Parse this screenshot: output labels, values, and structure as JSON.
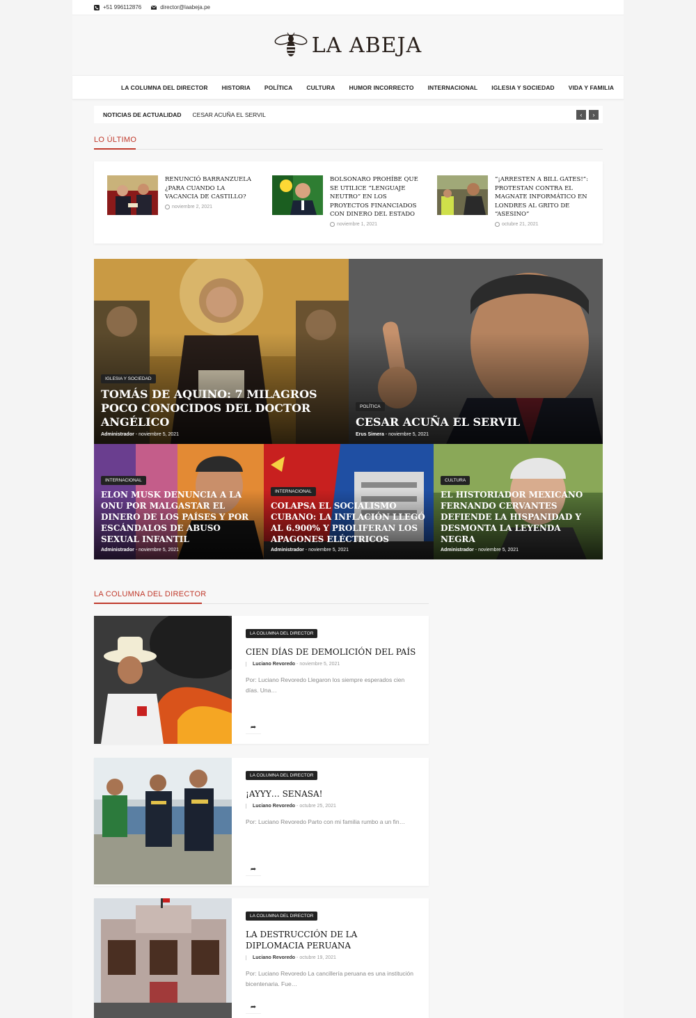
{
  "topbar": {
    "phone": "+51 996112876",
    "email": "director@laabeja.pe",
    "phone_icon": "phone-icon",
    "email_icon": "envelope-icon"
  },
  "brand": {
    "name": "LA ABEJA",
    "logo_icon": "bee-icon"
  },
  "nav": {
    "items": [
      "LA COLUMNA DEL DIRECTOR",
      "HISTORIA",
      "POLÍTICA",
      "CULTURA",
      "HUMOR INCORRECTO",
      "INTERNACIONAL",
      "IGLESIA Y SOCIEDAD",
      "VIDA Y FAMILIA"
    ],
    "menu_icon": "hamburger-icon",
    "search_icon": "search-icon"
  },
  "ticker": {
    "label": "NOTICIAS DE ACTUALIDAD",
    "text": "CESAR ACUÑA EL SERVIL",
    "prev_icon": "chevron-left-icon",
    "next_icon": "chevron-right-icon"
  },
  "latest": {
    "title": "LO ÚLTIMO",
    "items": [
      {
        "title": "RENUNCIÓ BARRANZUELA ¿PARA CUANDO LA VACANCIA DE CASTILLO?",
        "date": "noviembre 2, 2021"
      },
      {
        "title": "BOLSONARO PROHÍBE QUE SE UTILICE “LENGUAJE NEUTRO” EN LOS PROYECTOS FINANCIADOS CON DINERO DEL ESTADO",
        "date": "noviembre 1, 2021"
      },
      {
        "title": "“¡ARRESTEN A BILL GATES!”: PROTESTAN CONTRA EL MAGNATE INFORMÁTICO EN LONDRES AL GRITO DE “ASESINO”",
        "date": "octubre 21, 2021"
      }
    ]
  },
  "featured": {
    "top": [
      {
        "category": "IGLESIA Y SOCIEDAD",
        "title": "TOMÁS DE AQUINO: 7 MILAGROS POCO CONOCIDOS DEL DOCTOR ANGÉLICO",
        "author": "Administrador",
        "date": "noviembre 5, 2021"
      },
      {
        "category": "POLÍTICA",
        "title": "CESAR ACUÑA EL SERVIL",
        "author": "Erus Simera",
        "date": "noviembre 5, 2021"
      }
    ],
    "bottom": [
      {
        "category": "INTERNACIONAL",
        "title": "ELON MUSK DENUNCIA A LA ONU POR MALGASTAR EL DINERO DE LOS PAÍSES Y POR ESCÁNDALOS DE ABUSO SEXUAL INFANTIL",
        "author": "Administrador",
        "date": "noviembre 5, 2021"
      },
      {
        "category": "INTERNACIONAL",
        "title": "COLAPSA EL SOCIALISMO CUBANO: LA INFLACIÓN LLEGÓ AL 6.900% Y PROLIFERAN LOS APAGONES ELÉCTRICOS",
        "author": "Administrador",
        "date": "noviembre 5, 2021"
      },
      {
        "category": "CULTURA",
        "title": "EL HISTORIADOR MEXICANO FERNANDO CERVANTES DEFIENDE LA HISPANIDAD Y DESMONTA LA LEYENDA NEGRA",
        "author": "Administrador",
        "date": "noviembre 5, 2021"
      }
    ]
  },
  "column": {
    "title": "LA COLUMNA DEL DIRECTOR",
    "posts": [
      {
        "category": "LA COLUMNA DEL DIRECTOR",
        "title": "CIEN DÍAS DE DEMOLICIÓN DEL PAÍS",
        "author": "Luciano Revoredo",
        "date": "noviembre 5, 2021",
        "excerpt": "Por: Luciano Revoredo Llegaron los siempre esperados cien días. Una…"
      },
      {
        "category": "LA COLUMNA DEL DIRECTOR",
        "title": "¡AYYY… SENASA!",
        "author": "Luciano Revoredo",
        "date": "octubre 25, 2021",
        "excerpt": "Por: Luciano Revoredo Parto con mi familia rumbo a un fin…"
      },
      {
        "category": "LA COLUMNA DEL DIRECTOR",
        "title": "LA DESTRUCCIÓN DE LA DIPLOMACIA PERUANA",
        "author": "Luciano Revoredo",
        "date": "octubre 19, 2021",
        "excerpt": "Por: Luciano Revoredo La cancillería peruana es una institución bicentenaria. Fue…"
      }
    ],
    "share_icon": "share-icon"
  },
  "colors": {
    "accent": "#c0392b",
    "badge": "#222222"
  }
}
